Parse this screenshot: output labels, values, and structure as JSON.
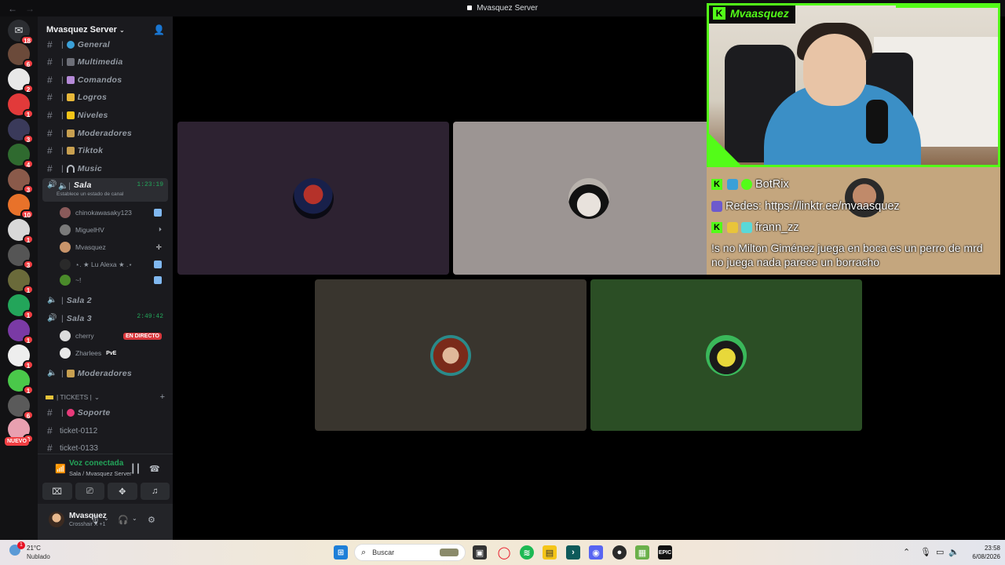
{
  "window": {
    "title": "Mvasquez Server"
  },
  "server": {
    "name": "Mvasquez Server"
  },
  "rail": {
    "badges": [
      "18",
      "6",
      "2",
      "1",
      "3",
      "4",
      "3",
      "10",
      "1",
      "3",
      "1",
      "1",
      "1",
      "1",
      "1",
      "6",
      "3"
    ],
    "new_label": "NUEVO"
  },
  "channels": [
    {
      "name": "General",
      "icon": "globe"
    },
    {
      "name": "Multimedia",
      "icon": "camera"
    },
    {
      "name": "Comandos",
      "icon": "robot"
    },
    {
      "name": "Logros",
      "icon": "trophy"
    },
    {
      "name": "Niveles",
      "icon": "star"
    },
    {
      "name": "Moderadores",
      "icon": "crown"
    },
    {
      "name": "Tiktok",
      "icon": "crown"
    },
    {
      "name": "Music",
      "icon": "headphones"
    }
  ],
  "voice_sala": {
    "name": "Sala",
    "timer": "1:23:19",
    "status": "Establece un estado de canal",
    "members": [
      "chinokawasaky123",
      "MiguelHV",
      "Mvasquez",
      "⋆. ★ Lu Alexa ★ .⋆",
      "~!"
    ]
  },
  "voice_sala2": {
    "name": "Sala 2"
  },
  "voice_sala3": {
    "name": "Sala 3",
    "timer": "2:49:42",
    "members": [
      "cherry",
      "Zharlees"
    ],
    "live_label": "EN DIRECTO",
    "pve_label": "PvE"
  },
  "voice_mods": {
    "name": "Moderadores"
  },
  "tickets_category": {
    "label": "| TICKETS |"
  },
  "ticket_channels": [
    {
      "name": "Soporte"
    },
    {
      "name": "ticket-0112"
    },
    {
      "name": "ticket-0133"
    }
  ],
  "voice_connected": {
    "title": "Voz conectada",
    "subtitle": "Sala / Mvasquez Server"
  },
  "user": {
    "name": "Mvasquez",
    "status": "Crosshair X +1"
  },
  "stream_overlay": {
    "streamer": "Mvaasquez",
    "chat": [
      {
        "user": "BotRix"
      },
      {
        "text": "Redes: https://linktr.ee/mvaasquez"
      },
      {
        "user": "frann_zz"
      }
    ],
    "message": "!s no Milton Giménez juega en boca es un perro de mrd no juega nada parece un borracho"
  },
  "colors": {
    "rail_bg": "#121214",
    "sidebar_bg": "#1a1a1e",
    "accent_green": "#23a55a",
    "kick_green": "#53fc18",
    "danger": "#da373c",
    "tile_colors": [
      "#2d2231",
      "#9c9593",
      "#39352e",
      "#2b4e25"
    ]
  },
  "taskbar": {
    "weather_temp": "21°C",
    "weather_cond": "Nublado",
    "weather_badge": "1",
    "search_placeholder": "Buscar",
    "time": "23:58",
    "date": "6/08/2026"
  }
}
